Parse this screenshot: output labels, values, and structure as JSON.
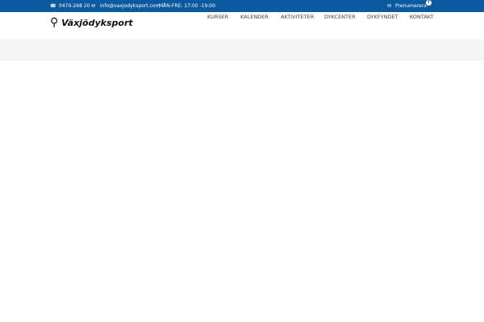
{
  "topbar": {
    "phone": "0470-268 20",
    "email": "info@vaxjodyksport.com",
    "hours": "MÅN-FRE: 17:00 -19:00",
    "subscribe": "Prenumerera",
    "facebook": "f"
  },
  "logo": "Växjödyksport",
  "nav": [
    "KURSER",
    "KALENDER",
    "AKTIVITETER",
    "DYKCENTER",
    "DYKFYNDET",
    "KONTAKT"
  ]
}
